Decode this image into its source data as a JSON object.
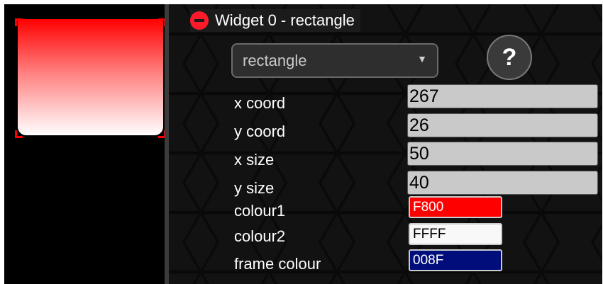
{
  "preview": {
    "gradient_top": "#ff0000",
    "gradient_bottom": "#ffffff",
    "frame_colour": "#ff0000"
  },
  "widget": {
    "title": "Widget 0 - rectangle",
    "type_value": "rectangle",
    "help_label": "?",
    "properties": [
      {
        "label": "x coord",
        "value": "267"
      },
      {
        "label": "y coord",
        "value": "26"
      },
      {
        "label": "x size",
        "value": "50"
      },
      {
        "label": "y size",
        "value": "40"
      }
    ],
    "colours": [
      {
        "label": "colour1",
        "value": "F800",
        "bg": "#ff0000",
        "text": "#ffffff"
      },
      {
        "label": "colour2",
        "value": "FFFF",
        "bg": "#f8f8f8",
        "text": "#000000"
      },
      {
        "label": "frame colour",
        "value": "008F",
        "bg": "#000d7a",
        "text": "#ffffff"
      }
    ]
  },
  "colors": {
    "collapse_icon": "#ff1a2a",
    "panel_bg": "#121212",
    "input_bg": "#c9c9c9"
  }
}
